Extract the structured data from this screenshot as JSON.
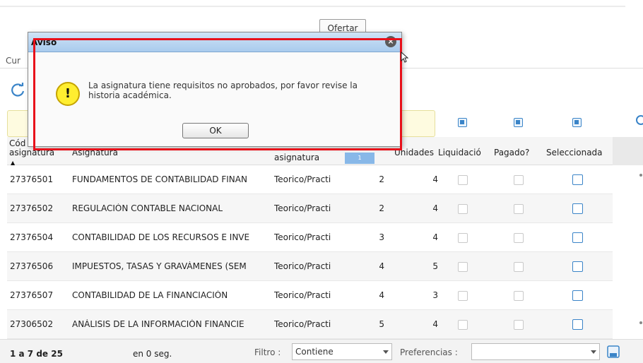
{
  "toolbar": {
    "ofertar_label": "Ofertar"
  },
  "section": {
    "label": "Cur"
  },
  "grid": {
    "headers": {
      "code_line1": "Cód",
      "code_line2": "asignatura",
      "name": "Asignatura",
      "type_line2": "asignatura",
      "sort_badge": "1",
      "units": "Unidades",
      "liquidacion": "Liquidació",
      "pagado": "Pagado?",
      "seleccionada": "Seleccionada"
    },
    "rows": [
      {
        "code": "27376501",
        "name": "FUNDAMENTOS DE CONTABILIDAD FINAN",
        "type": "Teorico/Practi",
        "semester": "2",
        "units": "4"
      },
      {
        "code": "27376502",
        "name": "REGULACIÓN CONTABLE NACIONAL",
        "type": "Teorico/Practi",
        "semester": "2",
        "units": "4"
      },
      {
        "code": "27376504",
        "name": "CONTABILIDAD DE LOS RECURSOS E INVE",
        "type": "Teorico/Practi",
        "semester": "3",
        "units": "4"
      },
      {
        "code": "27376506",
        "name": "IMPUESTOS, TASAS Y GRAVÁMENES (SEM",
        "type": "Teorico/Practi",
        "semester": "4",
        "units": "5"
      },
      {
        "code": "27376507",
        "name": "CONTABILIDAD DE LA FINANCIACIÓN",
        "type": "Teorico/Practi",
        "semester": "4",
        "units": "3"
      },
      {
        "code": "27306502",
        "name": "ANÁLISIS DE LA INFORMACIÓN FINANCIE",
        "type": "Teorico/Practi",
        "semester": "5",
        "units": "4"
      }
    ]
  },
  "footer": {
    "range": "1 a 7 de 25",
    "time": "en 0 seg.",
    "filtro_label": "Filtro :",
    "filtro_value": "Contiene",
    "preferencias_label": "Preferencias :",
    "preferencias_value": ""
  },
  "dialog": {
    "title": "Aviso",
    "close_symbol": "×",
    "warning_symbol": "!",
    "message": "La asignatura tiene requisitos no aprobados, por favor revise la historia académica.",
    "ok_label": "OK"
  },
  "colors": {
    "accent": "#3a84c8",
    "highlight": "#e8101a",
    "warning": "#ffee30"
  }
}
